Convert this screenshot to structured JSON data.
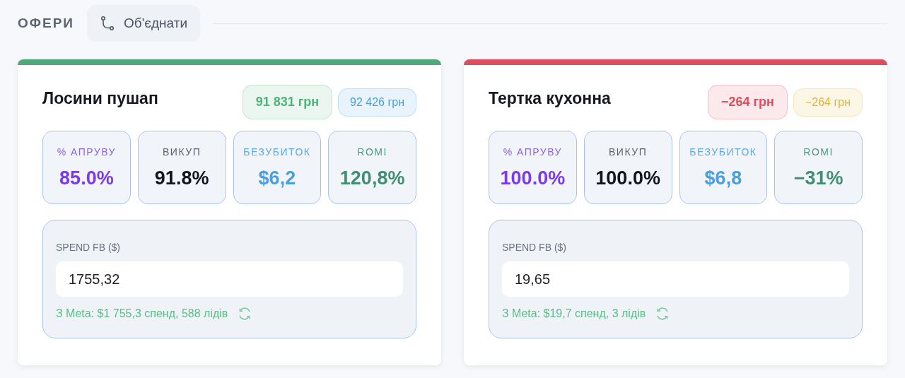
{
  "header": {
    "title": "ОФЕРИ",
    "merge_button": "Об'єднати"
  },
  "offers": [
    {
      "name": "Лосини пушап",
      "color": "#4fa87a",
      "badges": [
        {
          "text": "91 831 грн",
          "color": "#4fb47a"
        },
        {
          "text": "92 426 грн",
          "color": "#4a9fe0"
        }
      ],
      "metrics": [
        {
          "kind": "approve",
          "label": "% АПРУВУ",
          "value": "85.0%"
        },
        {
          "kind": "buyout",
          "label": "ВИКУП",
          "value": "91.8%"
        },
        {
          "kind": "breakeven",
          "label": "БЕЗУБИТОК",
          "value": "$6,2"
        },
        {
          "kind": "romi",
          "label": "ROMI",
          "value": "120,8%"
        }
      ],
      "spend": {
        "label": "SPEND FB ($)",
        "value": "1755,32",
        "meta": "З Meta: $1 755,3 спенд, 588 лідів"
      }
    },
    {
      "name": "Тертка кухонна",
      "color": "#e04c5f",
      "badges": [
        {
          "text": "−264 грн",
          "color": "#e04c5f"
        },
        {
          "text": "−264 грн",
          "color": "#e6b23c"
        }
      ],
      "metrics": [
        {
          "kind": "approve",
          "label": "% АПРУВУ",
          "value": "100.0%"
        },
        {
          "kind": "buyout",
          "label": "ВИКУП",
          "value": "100.0%"
        },
        {
          "kind": "breakeven",
          "label": "БЕЗУБИТОК",
          "value": "$6,8"
        },
        {
          "kind": "romi",
          "label": "ROMI",
          "value": "−31%"
        }
      ],
      "spend": {
        "label": "SPEND FB ($)",
        "value": "19,65",
        "meta": "З Meta: $19,7 спенд, 3 лідів"
      }
    }
  ]
}
